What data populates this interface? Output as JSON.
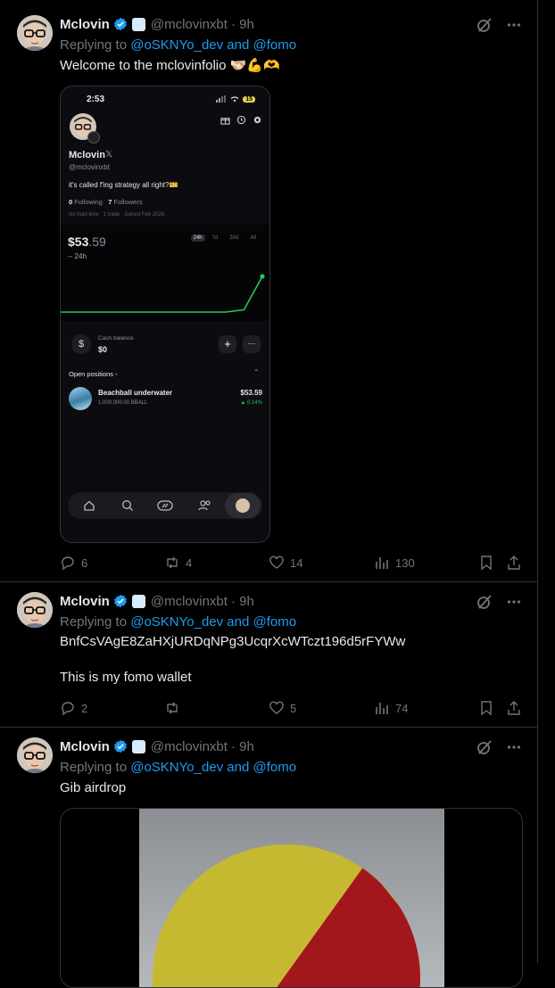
{
  "colors": {
    "accent": "#1d9bf0",
    "muted": "#71767b",
    "up": "#22c55e",
    "border": "#2f3336"
  },
  "posts": [
    {
      "name": "Mclovin",
      "handle": "@mclovinxbt",
      "time": "· 9h",
      "replying_prefix": "Replying to ",
      "replying_users": "@oSKNYo_dev and @fomo",
      "text": "Welcome to the mclovinfolio 🫱🏻‍🫲🏼💪🫶",
      "replies": "6",
      "reposts": "4",
      "likes": "14",
      "views": "130"
    },
    {
      "name": "Mclovin",
      "handle": "@mclovinxbt",
      "time": "· 9h",
      "replying_prefix": "Replying to ",
      "replying_users": "@oSKNYo_dev and @fomo",
      "text_line1": "BnfCsVAgE8ZaHXjURDqNPg3UcqrXcWTczt196d5rFYWw",
      "text_line2": "This is my fomo wallet",
      "replies": "2",
      "reposts": "",
      "likes": "5",
      "views": "74"
    },
    {
      "name": "Mclovin",
      "handle": "@mclovinxbt",
      "time": "· 9h",
      "replying_prefix": "Replying to ",
      "replying_users": "@oSKNYo_dev and @fomo",
      "text": "Gib airdrop"
    }
  ],
  "phone": {
    "clock": "2:53",
    "battery": "15",
    "profile_name": "Mclovin",
    "profile_handle": "@mclovinxbt",
    "bio": "it's called f'ing strategy all right?🎫",
    "following_count": "0",
    "following_label": "Following",
    "followers_count": "7",
    "followers_label": "Followers",
    "meta_hold": "No hold time",
    "meta_trades": "1 trade",
    "meta_joined": "Joined Feb 2026",
    "value_main": "$53",
    "value_cents": ".59",
    "change": "-- 24h",
    "ranges": [
      "24h",
      "7d",
      "30d",
      "All"
    ],
    "chart_series": [
      53.28,
      53.28,
      53.28,
      53.28,
      53.28,
      53.28,
      53.28,
      53.28,
      53.28,
      53.28,
      53.3,
      53.59
    ],
    "cash_label": "Cash balance",
    "cash_value": "$0",
    "positions_label": "Open positions",
    "position_name": "Beachball underwater",
    "position_amount": "1,000,000.00 BBALL",
    "position_value": "$53.59",
    "position_change": "▲ 0.14%"
  }
}
